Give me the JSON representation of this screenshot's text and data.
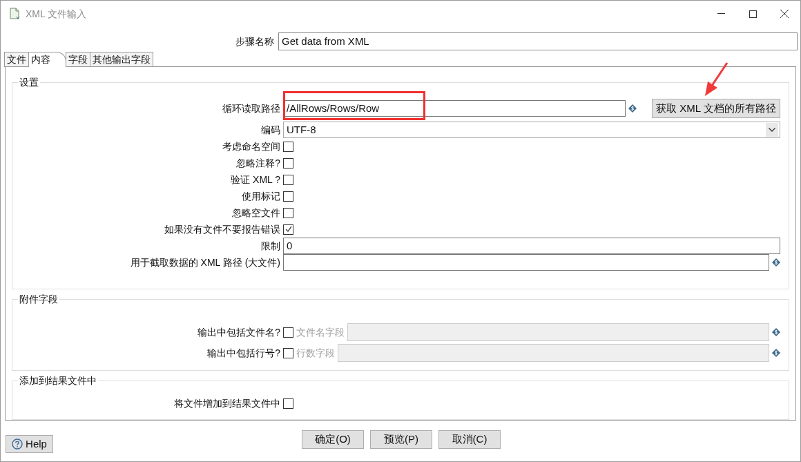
{
  "window": {
    "title": "XML 文件输入"
  },
  "step_name": {
    "label": "步骤名称",
    "value": "Get data from XML"
  },
  "tabs": [
    {
      "label": "文件",
      "selected": false
    },
    {
      "label": "内容",
      "selected": true
    },
    {
      "label": "字段",
      "selected": false
    },
    {
      "label": "其他输出字段",
      "selected": false
    }
  ],
  "settings": {
    "title": "设置",
    "rows": [
      {
        "kind": "text",
        "label": "循环读取路径",
        "value": "/AllRows/Rows/Row",
        "variable": true,
        "button": "获取 XML 文档的所有路径"
      },
      {
        "kind": "select",
        "label": "编码",
        "value": "UTF-8"
      },
      {
        "kind": "checkbox",
        "label": "考虑命名空间",
        "checked": false
      },
      {
        "kind": "checkbox",
        "label": "忽略注释?",
        "checked": false
      },
      {
        "kind": "checkbox",
        "label": "验证 XML ?",
        "checked": false
      },
      {
        "kind": "checkbox",
        "label": "使用标记",
        "checked": false
      },
      {
        "kind": "checkbox",
        "label": "忽略空文件",
        "checked": false
      },
      {
        "kind": "checkbox",
        "label": "如果没有文件不要报告错误",
        "checked": true
      },
      {
        "kind": "text",
        "label": "限制",
        "value": "0",
        "variable": false
      },
      {
        "kind": "text",
        "label": "用于截取数据的 XML 路径 (大文件)",
        "variable": true
      }
    ]
  },
  "additional_fields": {
    "title": "附件字段",
    "rows": [
      {
        "label": "输出中包括文件名?",
        "checked": false,
        "field_label": "文件名字段",
        "disabled": true
      },
      {
        "label": "输出中包括行号?",
        "checked": false,
        "field_label": "行数字段",
        "disabled": true
      }
    ]
  },
  "result_files": {
    "title": "添加到结果文件中",
    "rows": [
      {
        "label": "将文件增加到结果文件中",
        "checked": false
      }
    ]
  },
  "help_button": "Help",
  "buttons": [
    "确定(O)",
    "预览(P)",
    "取消(C)"
  ]
}
